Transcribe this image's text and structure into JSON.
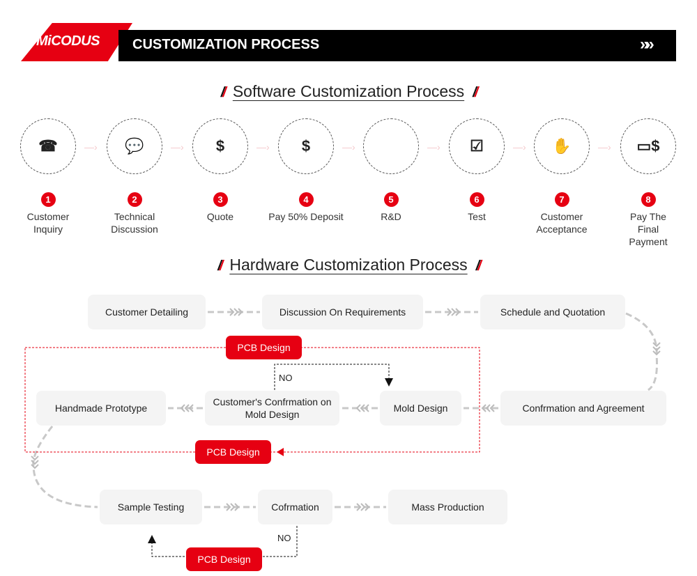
{
  "header": {
    "logo": "MiCODUS",
    "title": "CUSTOMIZATION PROCESS",
    "arrow": "»»"
  },
  "software": {
    "title": "Software Customization Process",
    "steps": [
      {
        "num": "1",
        "label": "Customer Inquiry",
        "icon": "customer-service-icon"
      },
      {
        "num": "2",
        "label": "Technical Discussion",
        "icon": "discussion-icon"
      },
      {
        "num": "3",
        "label": "Quote",
        "icon": "quote-icon"
      },
      {
        "num": "4",
        "label": "Pay 50% Deposit",
        "icon": "money-bag-icon"
      },
      {
        "num": "5",
        "label": "R&D",
        "icon": "computer-code-icon"
      },
      {
        "num": "6",
        "label": "Test",
        "icon": "clipboard-checklist-icon"
      },
      {
        "num": "7",
        "label": "Customer Acceptance",
        "icon": "hand-document-icon"
      },
      {
        "num": "8",
        "label": "Pay The Final Payment",
        "icon": "cash-payment-icon"
      }
    ]
  },
  "hardware": {
    "title": "Hardware Customization Process",
    "boxes": {
      "customer_detailing": "Customer Detailing",
      "discussion": "Discussion On Requirements",
      "schedule": "Schedule and Quotation",
      "confirmation_agreement": "Confrmation and Agreement",
      "mold_design": "Mold Design",
      "customer_confirmation": "Customer's Confrmation on Mold Design",
      "handmade": "Handmade Prototype",
      "sample_testing": "Sample Testing",
      "cofrmation": "Cofrmation",
      "mass_production": "Mass Production"
    },
    "pcb_label": "PCB Design",
    "no_label": "NO"
  },
  "colors": {
    "accent": "#e60012",
    "box": "#f4f4f4",
    "connector": "#c8c8c8"
  }
}
